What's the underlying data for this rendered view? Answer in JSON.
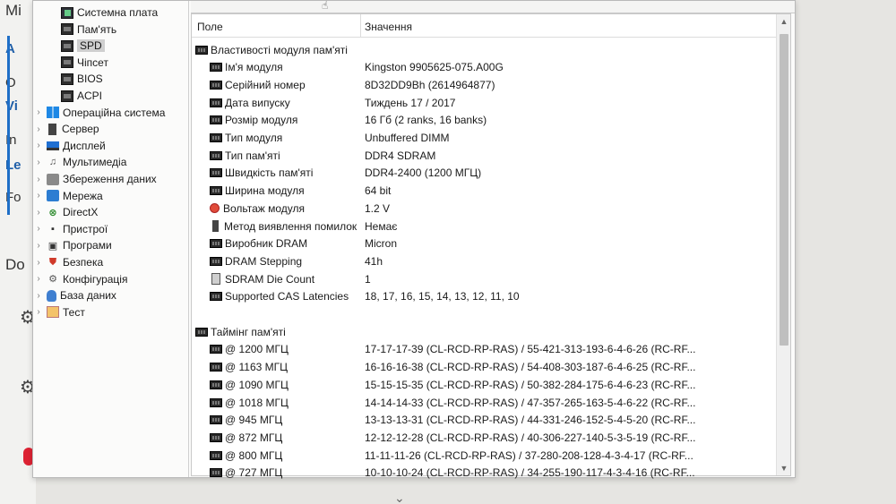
{
  "background_app": {
    "fragments": [
      "Mi",
      "A",
      "O",
      "Vi",
      "In",
      "Le",
      "Fo",
      "Do"
    ]
  },
  "tree": {
    "items": [
      {
        "label": "Системна плата",
        "icon": "motherboard-icon",
        "indent": 2
      },
      {
        "label": "Пам'ять",
        "icon": "memory-chip-icon",
        "indent": 2
      },
      {
        "label": "SPD",
        "icon": "memory-chip-icon",
        "indent": 2,
        "selected": true
      },
      {
        "label": "Чіпсет",
        "icon": "chipset-icon",
        "indent": 2
      },
      {
        "label": "BIOS",
        "icon": "chip-icon",
        "indent": 2
      },
      {
        "label": "ACPI",
        "icon": "chip-icon",
        "indent": 2
      },
      {
        "label": "Операційна система",
        "icon": "windows-icon",
        "indent": 1
      },
      {
        "label": "Сервер",
        "icon": "server-icon",
        "indent": 1
      },
      {
        "label": "Дисплей",
        "icon": "display-icon",
        "indent": 1
      },
      {
        "label": "Мультимедіа",
        "icon": "multimedia-icon",
        "indent": 1
      },
      {
        "label": "Збереження даних",
        "icon": "storage-icon",
        "indent": 1
      },
      {
        "label": "Мережа",
        "icon": "network-icon",
        "indent": 1
      },
      {
        "label": "DirectX",
        "icon": "directx-icon",
        "indent": 1
      },
      {
        "label": "Пристрої",
        "icon": "devices-icon",
        "indent": 1
      },
      {
        "label": "Програми",
        "icon": "programs-icon",
        "indent": 1
      },
      {
        "label": "Безпека",
        "icon": "security-shield-icon",
        "indent": 1
      },
      {
        "label": "Конфігурація",
        "icon": "configuration-icon",
        "indent": 1
      },
      {
        "label": "База даних",
        "icon": "database-icon",
        "indent": 1
      },
      {
        "label": "Тест",
        "icon": "test-icon",
        "indent": 1
      }
    ]
  },
  "detail": {
    "columns": {
      "field": "Поле",
      "value": "Значення"
    },
    "sections": [
      {
        "title": "Властивості модуля пам'яті",
        "rows": [
          {
            "field": "Ім'я модуля",
            "value": "Kingston 9905625-075.A00G",
            "icon": "ram"
          },
          {
            "field": "Серійний номер",
            "value": "8D32DD9Bh (2614964877)",
            "icon": "ram"
          },
          {
            "field": "Дата випуску",
            "value": "Тиждень 17 / 2017",
            "icon": "ram"
          },
          {
            "field": "Розмір модуля",
            "value": "16 Гб (2 ranks, 16 banks)",
            "icon": "ram"
          },
          {
            "field": "Тип модуля",
            "value": "Unbuffered DIMM",
            "icon": "ram"
          },
          {
            "field": "Тип пам'яті",
            "value": "DDR4 SDRAM",
            "icon": "ram"
          },
          {
            "field": "Швидкість пам'яті",
            "value": "DDR4-2400 (1200 МГЦ)",
            "icon": "ram"
          },
          {
            "field": "Ширина модуля",
            "value": "64 bit",
            "icon": "ram"
          },
          {
            "field": "Вольтаж модуля",
            "value": "1.2 V",
            "icon": "volt"
          },
          {
            "field": "Метод виявлення помилок",
            "value": "Немає",
            "icon": "stick"
          },
          {
            "field": "Виробник DRAM",
            "value": "Micron",
            "icon": "ram"
          },
          {
            "field": "DRAM Stepping",
            "value": "41h",
            "icon": "ram"
          },
          {
            "field": "SDRAM Die Count",
            "value": "1",
            "icon": "die"
          },
          {
            "field": "Supported CAS Latencies",
            "value": "18, 17, 16, 15, 14, 13, 12, 11, 10",
            "icon": "ram"
          }
        ]
      },
      {
        "title": "Таймінг пам'яті",
        "rows": [
          {
            "field": "@ 1200 МГЦ",
            "value": "17-17-17-39  (CL-RCD-RP-RAS) / 55-421-313-193-6-4-6-26  (RC-RF...",
            "icon": "ram"
          },
          {
            "field": "@ 1163 МГЦ",
            "value": "16-16-16-38  (CL-RCD-RP-RAS) / 54-408-303-187-6-4-6-25  (RC-RF...",
            "icon": "ram"
          },
          {
            "field": "@ 1090 МГЦ",
            "value": "15-15-15-35  (CL-RCD-RP-RAS) / 50-382-284-175-6-4-6-23  (RC-RF...",
            "icon": "ram"
          },
          {
            "field": "@ 1018 МГЦ",
            "value": "14-14-14-33  (CL-RCD-RP-RAS) / 47-357-265-163-5-4-6-22  (RC-RF...",
            "icon": "ram"
          },
          {
            "field": "@ 945 МГЦ",
            "value": "13-13-13-31  (CL-RCD-RP-RAS) / 44-331-246-152-5-4-5-20  (RC-RF...",
            "icon": "ram"
          },
          {
            "field": "@ 872 МГЦ",
            "value": "12-12-12-28  (CL-RCD-RP-RAS) / 40-306-227-140-5-3-5-19  (RC-RF...",
            "icon": "ram"
          },
          {
            "field": "@ 800 МГЦ",
            "value": "11-11-11-26  (CL-RCD-RP-RAS) / 37-280-208-128-4-3-4-17  (RC-RF...",
            "icon": "ram"
          },
          {
            "field": "@ 727 МГЦ",
            "value": "10-10-10-24  (CL-RCD-RP-RAS) / 34-255-190-117-4-3-4-16  (RC-RF...",
            "icon": "ram"
          }
        ]
      }
    ]
  }
}
